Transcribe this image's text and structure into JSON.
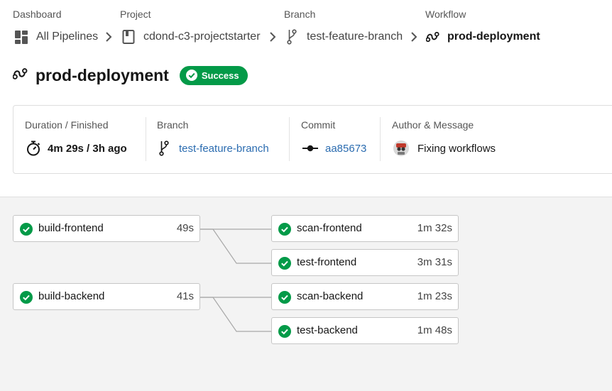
{
  "breadcrumb": {
    "items": [
      {
        "heading": "Dashboard",
        "label": "All Pipelines",
        "icon": "dashboard-icon"
      },
      {
        "heading": "Project",
        "label": "cdond-c3-projectstarter",
        "icon": "book-icon"
      },
      {
        "heading": "Branch",
        "label": "test-feature-branch",
        "icon": "git-branch-icon"
      },
      {
        "heading": "Workflow",
        "label": "prod-deployment",
        "icon": "workflow-icon"
      }
    ]
  },
  "workflow": {
    "title": "prod-deployment",
    "status": "Success",
    "status_color": "#039a48"
  },
  "details": {
    "duration_label": "Duration / Finished",
    "duration_value": "4m 29s / 3h ago",
    "branch_label": "Branch",
    "branch_value": "test-feature-branch",
    "commit_label": "Commit",
    "commit_value": "aa85673",
    "author_label": "Author & Message",
    "author_message": "Fixing workflows"
  },
  "jobs": [
    {
      "name": "build-frontend",
      "duration": "49s",
      "status": "success"
    },
    {
      "name": "build-backend",
      "duration": "41s",
      "status": "success"
    },
    {
      "name": "scan-frontend",
      "duration": "1m 32s",
      "status": "success"
    },
    {
      "name": "test-frontend",
      "duration": "3m 31s",
      "status": "success"
    },
    {
      "name": "scan-backend",
      "duration": "1m 23s",
      "status": "success"
    },
    {
      "name": "test-backend",
      "duration": "1m 48s",
      "status": "success"
    }
  ],
  "colors": {
    "success": "#039a48",
    "link": "#2b6cb0"
  }
}
